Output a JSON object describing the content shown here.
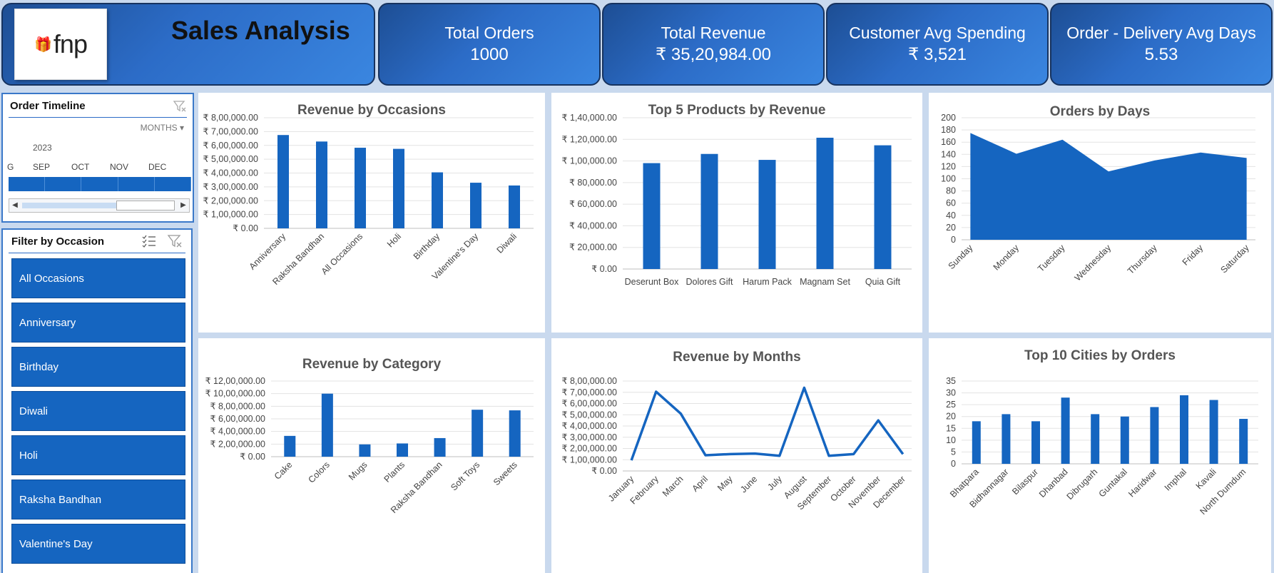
{
  "header": {
    "title": "Sales Analysis",
    "logo_text": "fnp",
    "kpis": [
      {
        "label": "Total Orders",
        "value": "1000"
      },
      {
        "label": "Total Revenue",
        "value": "₹ 35,20,984.00"
      },
      {
        "label": "Customer Avg Spending",
        "value": "₹ 3,521"
      },
      {
        "label": "Order - Delivery Avg Days",
        "value": "5.53"
      }
    ]
  },
  "timeline": {
    "title": "Order Timeline",
    "period_label": "MONTHS",
    "year": "2023",
    "months": [
      "G",
      "SEP",
      "OCT",
      "NOV",
      "DEC"
    ]
  },
  "occasion_filter": {
    "title": "Filter by Occasion",
    "items": [
      "All Occasions",
      "Anniversary",
      "Birthday",
      "Diwali",
      "Holi",
      "Raksha Bandhan",
      "Valentine's Day"
    ]
  },
  "colors": {
    "accent": "#1565c0",
    "header": "#2c6cc7",
    "background": "#c9d9ee"
  },
  "chart_data": [
    {
      "id": "occasions",
      "type": "bar",
      "title": "Revenue by Occasions",
      "categories": [
        "Anniversary",
        "Raksha Bandhan",
        "All Occasions",
        "Holi",
        "Birthday",
        "Valentine's Day",
        "Diwali"
      ],
      "values": [
        675000,
        628000,
        583000,
        575000,
        405000,
        330000,
        310000
      ],
      "ylim": [
        0,
        800000
      ],
      "yticks": [
        "₹ 0.00",
        "₹ 1,00,000.00",
        "₹ 2,00,000.00",
        "₹ 3,00,000.00",
        "₹ 4,00,000.00",
        "₹ 5,00,000.00",
        "₹ 6,00,000.00",
        "₹ 7,00,000.00",
        "₹ 8,00,000.00"
      ],
      "rotate_labels": true,
      "grid": true
    },
    {
      "id": "products",
      "type": "bar",
      "title": "Top 5 Products by Revenue",
      "categories": [
        "Deserunt Box",
        "Dolores Gift",
        "Harum Pack",
        "Magnam Set",
        "Quia Gift"
      ],
      "values": [
        98000,
        106500,
        101000,
        121500,
        114500
      ],
      "ylim": [
        0,
        140000
      ],
      "yticks": [
        "₹ 0.00",
        "₹ 20,000.00",
        "₹ 40,000.00",
        "₹ 60,000.00",
        "₹ 80,000.00",
        "₹ 1,00,000.00",
        "₹ 1,20,000.00",
        "₹ 1,40,000.00"
      ],
      "rotate_labels": false,
      "grid": true
    },
    {
      "id": "days",
      "type": "area",
      "title": "Orders by Days",
      "categories": [
        "Sunday",
        "Monday",
        "Tuesday",
        "Wednesday",
        "Thursday",
        "Friday",
        "Saturday"
      ],
      "values": [
        175,
        141,
        164,
        112,
        130,
        143,
        134
      ],
      "ylim": [
        0,
        200
      ],
      "yticks": [
        "0",
        "20",
        "40",
        "60",
        "80",
        "100",
        "120",
        "140",
        "160",
        "180",
        "200"
      ],
      "rotate_labels": true,
      "grid": true
    },
    {
      "id": "category",
      "type": "bar",
      "title": "Revenue by Category",
      "categories": [
        "Cake",
        "Colors",
        "Mugs",
        "Plants",
        "Raksha Bandhan",
        "Soft Toys",
        "Sweets"
      ],
      "values": [
        330000,
        1000000,
        195000,
        210000,
        295000,
        745000,
        735000
      ],
      "ylim": [
        0,
        1200000
      ],
      "yticks": [
        "₹ 0.00",
        "₹ 2,00,000.00",
        "₹ 4,00,000.00",
        "₹ 6,00,000.00",
        "₹ 8,00,000.00",
        "₹ 10,00,000.00",
        "₹ 12,00,000.00"
      ],
      "rotate_labels": true,
      "grid": true
    },
    {
      "id": "months",
      "type": "line",
      "title": "Revenue by Months",
      "categories": [
        "January",
        "February",
        "March",
        "April",
        "May",
        "June",
        "July",
        "August",
        "September",
        "October",
        "November",
        "December"
      ],
      "values": [
        95000,
        705000,
        510000,
        140000,
        150000,
        155000,
        135000,
        740000,
        135000,
        150000,
        450000,
        150000
      ],
      "ylim": [
        0,
        800000
      ],
      "yticks": [
        "₹ 0.00",
        "₹ 1,00,000.00",
        "₹ 2,00,000.00",
        "₹ 3,00,000.00",
        "₹ 4,00,000.00",
        "₹ 5,00,000.00",
        "₹ 6,00,000.00",
        "₹ 7,00,000.00",
        "₹ 8,00,000.00"
      ],
      "rotate_labels": true,
      "grid": true
    },
    {
      "id": "cities",
      "type": "bar",
      "title": "Top 10 Cities by Orders",
      "categories": [
        "Bhatpara",
        "Bidhannagar",
        "Bilaspur",
        "Dhanbad",
        "Dibrugarh",
        "Guntakal",
        "Haridwar",
        "Imphal",
        "Kavali",
        "North Dumdum"
      ],
      "values": [
        18,
        21,
        18,
        28,
        21,
        20,
        24,
        29,
        27,
        19
      ],
      "ylim": [
        0,
        35
      ],
      "yticks": [
        "0",
        "5",
        "10",
        "15",
        "20",
        "25",
        "30",
        "35"
      ],
      "rotate_labels": true,
      "grid": true
    }
  ]
}
